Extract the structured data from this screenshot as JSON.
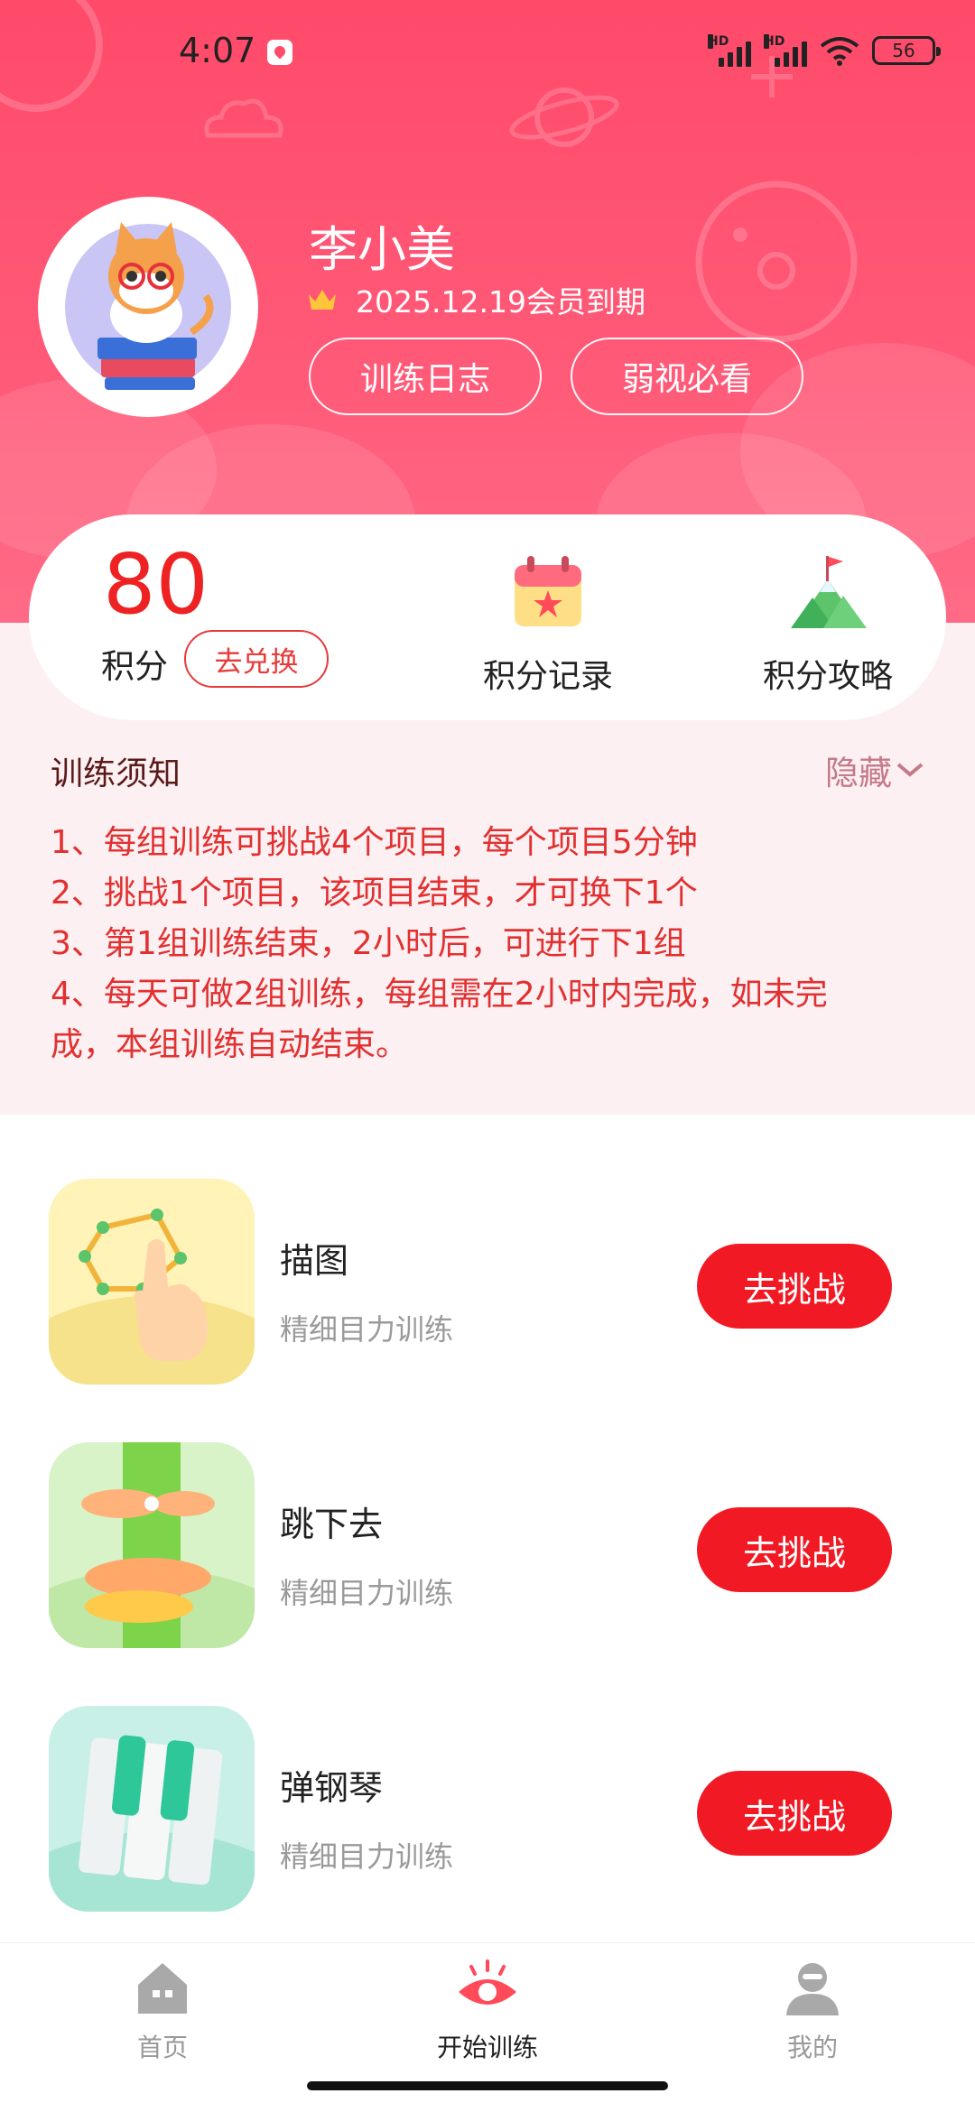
{
  "status_bar": {
    "time": "4:07",
    "signal_label": "HD",
    "battery": "56"
  },
  "profile": {
    "name": "李小美",
    "member_expiry": "2025.12.19会员到期",
    "buttons": {
      "training_log": "训练日志",
      "low_vision_must_see": "弱视必看"
    }
  },
  "points": {
    "value": "80",
    "label": "积分",
    "exchange": "去兑换",
    "records_label": "积分记录",
    "guide_label": "积分攻略"
  },
  "notice": {
    "title": "训练须知",
    "toggle": "隐藏",
    "lines": [
      "1、每组训练可挑战4个项目，每个项目5分钟",
      "2、挑战1个项目，该项目结束，才可换下1个",
      "3、第1组训练结束，2小时后，可进行下1组",
      "4、每天可做2组训练，每组需在2小时内完成，如未完",
      "成，本组训练自动结束。"
    ]
  },
  "trainings": [
    {
      "title": "描图",
      "subtitle": "精细目力训练",
      "button": "去挑战"
    },
    {
      "title": "跳下去",
      "subtitle": "精细目力训练",
      "button": "去挑战"
    },
    {
      "title": "弹钢琴",
      "subtitle": "精细目力训练",
      "button": "去挑战"
    }
  ],
  "tabs": [
    {
      "label": "首页"
    },
    {
      "label": "开始训练"
    },
    {
      "label": "我的"
    }
  ],
  "colors": {
    "header": "#ff4a6a",
    "accent_red": "#f11a24",
    "notice_text": "#e23030",
    "tab_active": "#222222",
    "tab_inactive": "#999999"
  }
}
